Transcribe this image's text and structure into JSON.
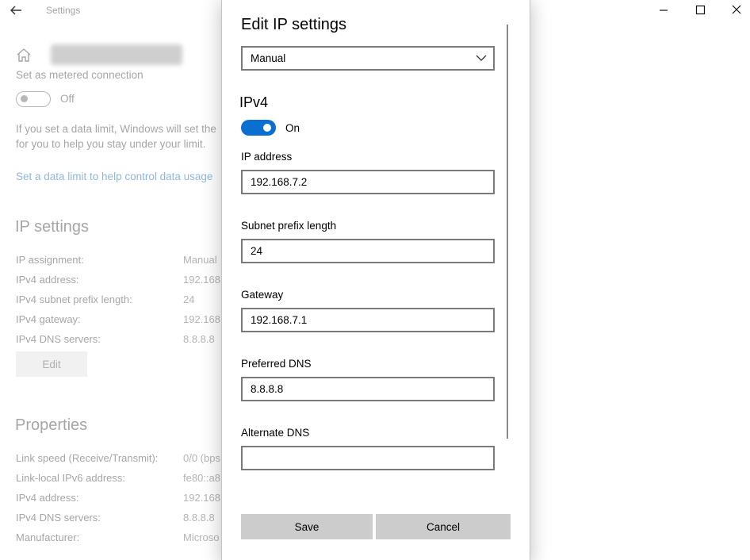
{
  "window": {
    "app_title": "Settings"
  },
  "background": {
    "metered_label": "Set as metered connection",
    "metered_toggle_state": "Off",
    "data_limit_text_1": "If you set a data limit, Windows will set the",
    "data_limit_text_2": "for you to help you stay under your limit.",
    "data_limit_link": "Set a data limit to help control data usage",
    "ip_settings_title": "IP settings",
    "ip_settings": [
      {
        "label": "IP assignment:",
        "value": "Manual"
      },
      {
        "label": "IPv4 address:",
        "value": "192.168."
      },
      {
        "label": "IPv4 subnet prefix length:",
        "value": "24"
      },
      {
        "label": "IPv4 gateway:",
        "value": "192.168."
      },
      {
        "label": "IPv4 DNS servers:",
        "value": "8.8.8.8"
      }
    ],
    "edit_button": "Edit",
    "properties_title": "Properties",
    "properties": [
      {
        "label": "Link speed (Receive/Transmit):",
        "value": "0/0 (bps"
      },
      {
        "label": "Link-local IPv6 address:",
        "value": "fe80::a8"
      },
      {
        "label": "IPv4 address:",
        "value": "192.168."
      },
      {
        "label": "IPv4 DNS servers:",
        "value": "8.8.8.8"
      },
      {
        "label": "Manufacturer:",
        "value": "Microso"
      }
    ]
  },
  "dialog": {
    "title": "Edit IP settings",
    "mode_selected": "Manual",
    "ipv4_title": "IPv4",
    "ipv4_toggle_state": "On",
    "fields": {
      "ip_address": {
        "label": "IP address",
        "value": "192.168.7.2"
      },
      "subnet_prefix": {
        "label": "Subnet prefix length",
        "value": "24"
      },
      "gateway": {
        "label": "Gateway",
        "value": "192.168.7.1"
      },
      "preferred_dns": {
        "label": "Preferred DNS",
        "value": "8.8.8.8"
      },
      "alternate_dns": {
        "label": "Alternate DNS",
        "value": ""
      }
    },
    "save_label": "Save",
    "cancel_label": "Cancel"
  },
  "colors": {
    "accent": "#0a6fd1",
    "link": "#8fb8df",
    "button_gray": "#cccccc"
  }
}
